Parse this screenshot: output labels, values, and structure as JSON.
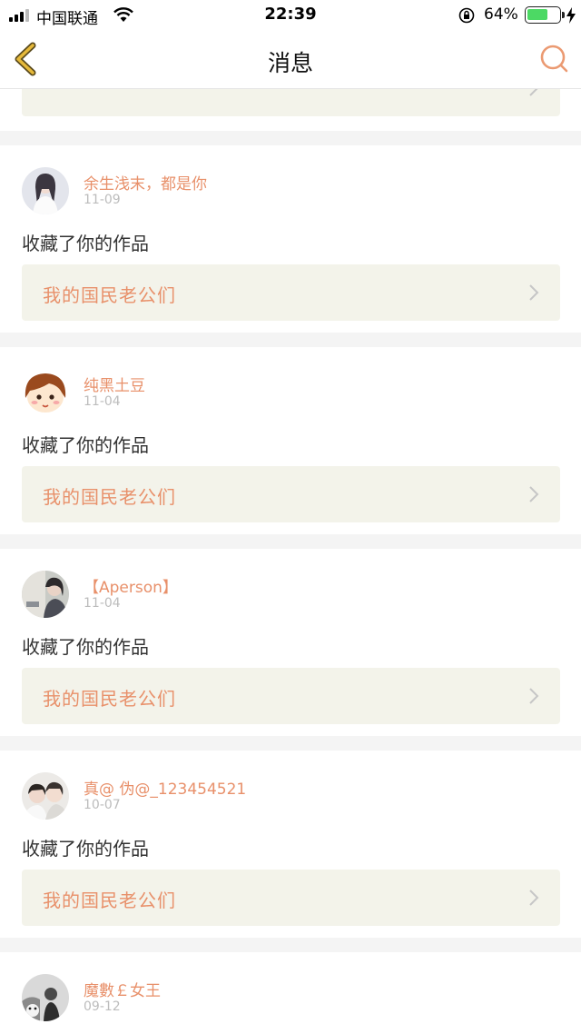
{
  "status_bar": {
    "carrier": "中国联通",
    "time": "22:39",
    "battery_percent": "64%",
    "battery_level": 0.64
  },
  "nav": {
    "title": "消息",
    "back_icon": "chevron-left-icon",
    "search_icon": "search-icon"
  },
  "colors": {
    "accent": "#e8906a",
    "nav_back": "#e6b93a",
    "link_bg": "#f3f3ea"
  },
  "messages": [
    {
      "username": "余生浅末，都是你",
      "date": "11-09",
      "action": "收藏了你的作品",
      "work_title": "我的国民老公们"
    },
    {
      "username": "纯黑土豆",
      "date": "11-04",
      "action": "收藏了你的作品",
      "work_title": "我的国民老公们"
    },
    {
      "username": "【Aperson】",
      "date": "11-04",
      "action": "收藏了你的作品",
      "work_title": "我的国民老公们"
    },
    {
      "username": "真@ 伪@_123454521",
      "date": "10-07",
      "action": "收藏了你的作品",
      "work_title": "我的国民老公们"
    },
    {
      "username": "魔數￡女王",
      "date": "09-12"
    }
  ]
}
